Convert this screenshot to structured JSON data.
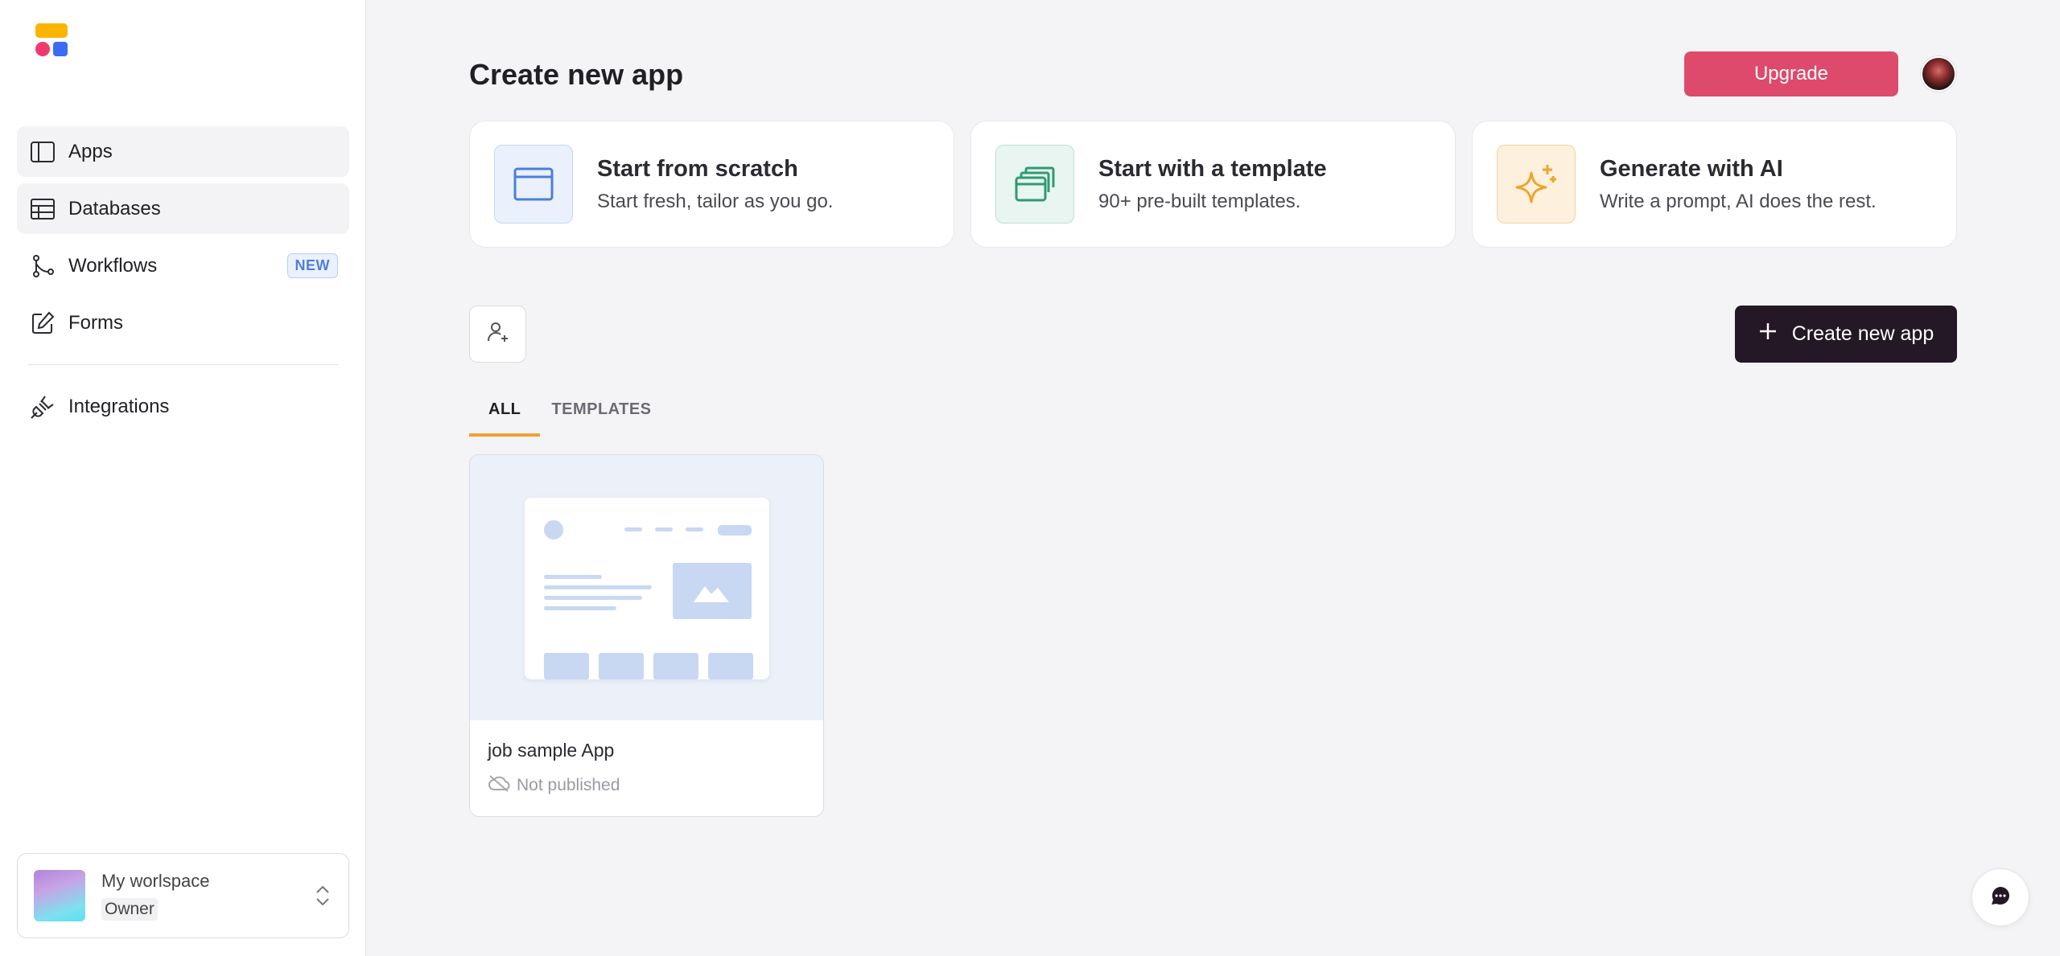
{
  "sidebar": {
    "items": [
      {
        "label": "Apps",
        "icon": "sidebar-layout-icon"
      },
      {
        "label": "Databases",
        "icon": "table-icon"
      },
      {
        "label": "Workflows",
        "icon": "workflow-icon",
        "badge": "NEW"
      },
      {
        "label": "Forms",
        "icon": "edit-form-icon"
      },
      {
        "label": "Integrations",
        "icon": "plug-icon"
      }
    ],
    "workspace": {
      "name": "My worlspace",
      "role": "Owner"
    }
  },
  "header": {
    "title": "Create new app",
    "upgrade_label": "Upgrade"
  },
  "start_cards": [
    {
      "title": "Start from scratch",
      "subtitle": "Start fresh, tailor as you go.",
      "icon": "window-icon"
    },
    {
      "title": "Start with a template",
      "subtitle": "90+ pre-built templates.",
      "icon": "templates-icon"
    },
    {
      "title": "Generate with AI",
      "subtitle": "Write a prompt, AI does the rest.",
      "icon": "sparkle-icon"
    }
  ],
  "toolbar": {
    "create_label": "Create new app"
  },
  "tabs": [
    {
      "label": "ALL"
    },
    {
      "label": "TEMPLATES"
    }
  ],
  "apps": [
    {
      "name": "job sample App",
      "status": "Not published"
    }
  ],
  "colors": {
    "accent": "#de4a6b",
    "primary_dark": "#241726",
    "tab_indicator": "#f0a030"
  }
}
